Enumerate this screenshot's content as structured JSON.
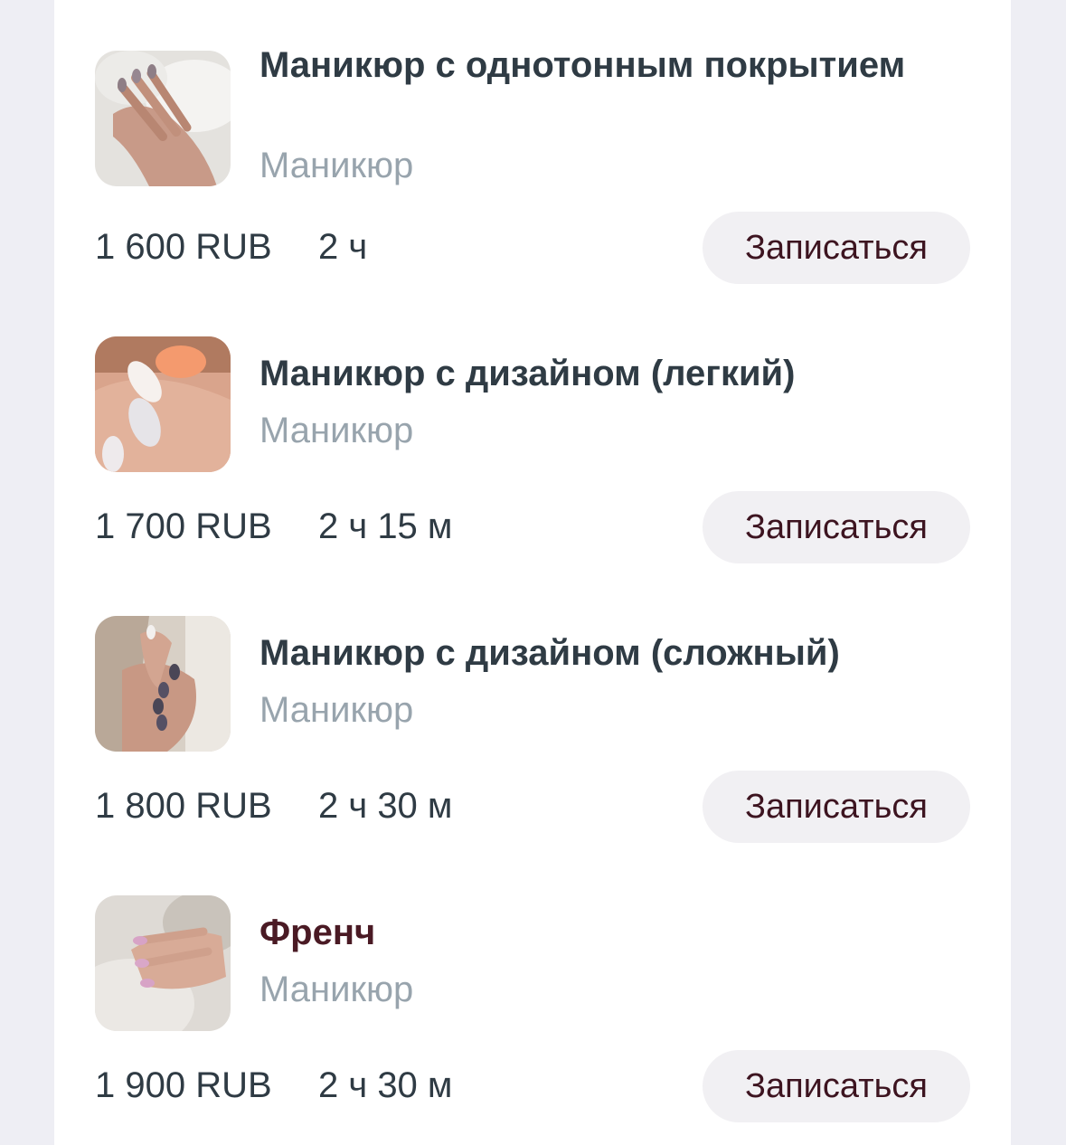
{
  "book_label": "Записаться",
  "services": [
    {
      "title": "Маникюр с однотонным покрытием",
      "category": "Маникюр",
      "price": "1 600 RUB",
      "duration": "2 ч"
    },
    {
      "title": "Маникюр с дизайном (легкий)",
      "category": "Маникюр",
      "price": "1 700 RUB",
      "duration": "2 ч 15 м"
    },
    {
      "title": "Маникюр с дизайном (сложный)",
      "category": "Маникюр",
      "price": "1 800 RUB",
      "duration": "2 ч 30 м"
    },
    {
      "title": "Френч",
      "category": "Маникюр",
      "price": "1 900 RUB",
      "duration": "2 ч 30 м"
    }
  ]
}
